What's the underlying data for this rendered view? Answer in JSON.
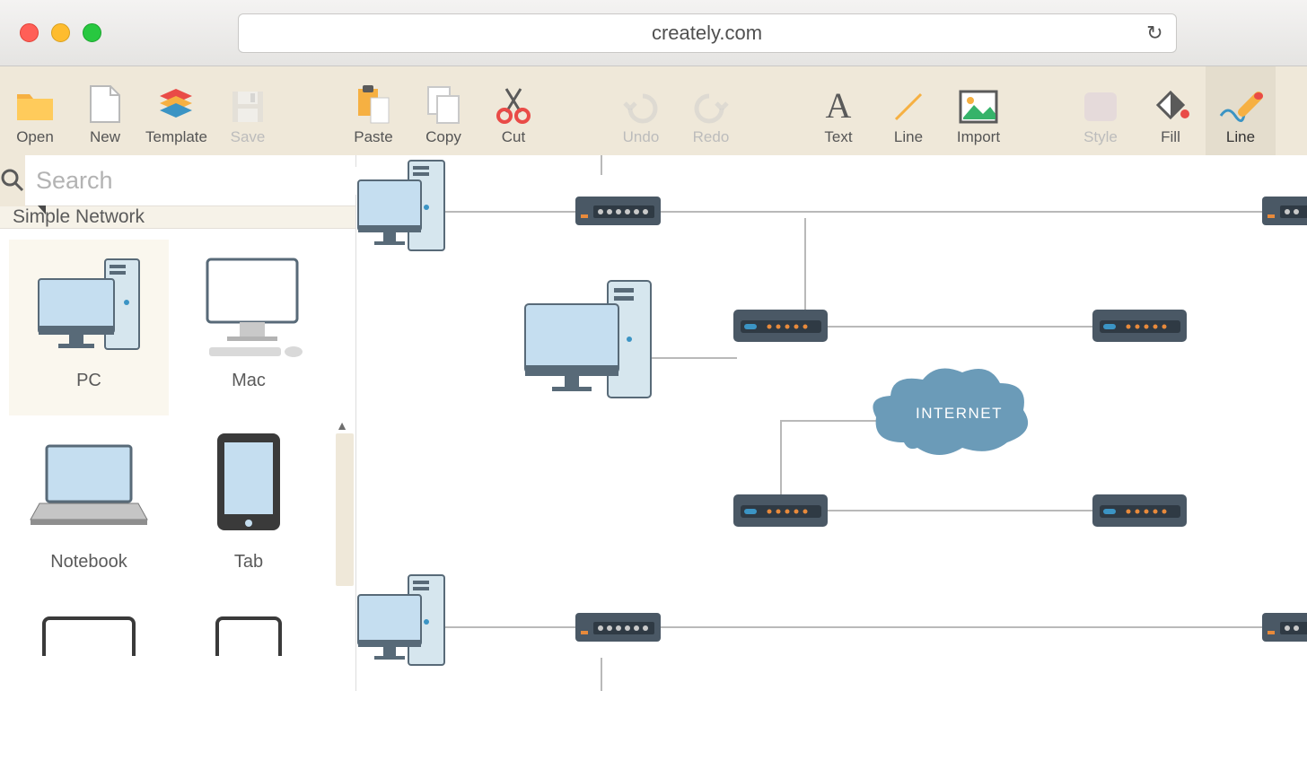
{
  "browser": {
    "url": "creately.com"
  },
  "toolbar": {
    "open": "Open",
    "new": "New",
    "template": "Template",
    "save": "Save",
    "paste": "Paste",
    "copy": "Copy",
    "cut": "Cut",
    "undo": "Undo",
    "redo": "Redo",
    "text": "Text",
    "line": "Line",
    "import": "Import",
    "style": "Style",
    "fill": "Fill",
    "line2": "Line"
  },
  "search": {
    "placeholder": "Search"
  },
  "category": "Simple Network",
  "shapes": {
    "pc": "PC",
    "mac": "Mac",
    "notebook": "Notebook",
    "tab": "Tab"
  },
  "canvas": {
    "internet": "INTERNET"
  }
}
